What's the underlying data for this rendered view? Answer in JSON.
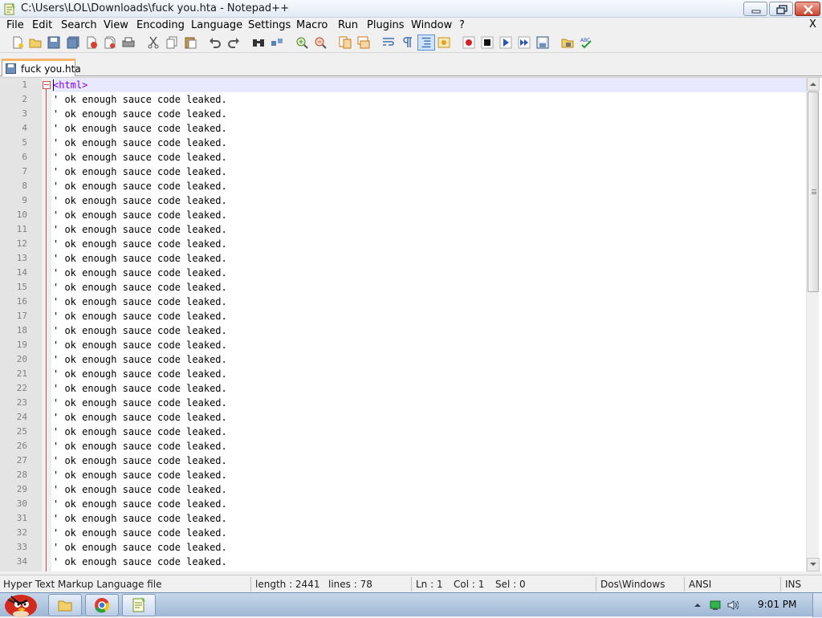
{
  "window": {
    "title": "C:\\Users\\LOL\\Downloads\\fuck you.hta - Notepad++",
    "close_glyph": "X"
  },
  "menu": {
    "items": [
      "File",
      "Edit",
      "Search",
      "View",
      "Encoding",
      "Language",
      "Settings",
      "Macro",
      "Run",
      "Plugins",
      "Window",
      "?"
    ],
    "doc_close": "X"
  },
  "toolbar": {
    "icons": [
      "new-file-icon",
      "open-file-icon",
      "save-icon",
      "save-all-icon",
      "close-icon",
      "close-all-icon",
      "print-icon",
      "cut-icon",
      "copy-icon",
      "paste-icon",
      "undo-icon",
      "redo-icon",
      "find-icon",
      "replace-icon",
      "zoom-in-icon",
      "zoom-out-icon",
      "sync-v-icon",
      "sync-h-icon",
      "word-wrap-icon",
      "show-all-chars-icon",
      "indent-guide-icon",
      "doc-map-icon",
      "record-macro-icon",
      "stop-record-icon",
      "play-macro-icon",
      "run-macro-multiple-icon",
      "save-macro-icon",
      "folder-icon",
      "spellcheck-icon"
    ]
  },
  "tabs": [
    {
      "label": "fuck you.hta",
      "active": true
    }
  ],
  "editor": {
    "lines": [
      {
        "n": "1",
        "text": "<html>",
        "tag": true
      },
      {
        "n": "2",
        "text": "' ok enough sauce code leaked."
      },
      {
        "n": "3",
        "text": "' ok enough sauce code leaked."
      },
      {
        "n": "4",
        "text": "' ok enough sauce code leaked."
      },
      {
        "n": "5",
        "text": "' ok enough sauce code leaked."
      },
      {
        "n": "6",
        "text": "' ok enough sauce code leaked."
      },
      {
        "n": "7",
        "text": "' ok enough sauce code leaked."
      },
      {
        "n": "8",
        "text": "' ok enough sauce code leaked."
      },
      {
        "n": "9",
        "text": "' ok enough sauce code leaked."
      },
      {
        "n": "10",
        "text": "' ok enough sauce code leaked."
      },
      {
        "n": "11",
        "text": "' ok enough sauce code leaked."
      },
      {
        "n": "12",
        "text": "' ok enough sauce code leaked."
      },
      {
        "n": "13",
        "text": "' ok enough sauce code leaked."
      },
      {
        "n": "14",
        "text": "' ok enough sauce code leaked."
      },
      {
        "n": "15",
        "text": "' ok enough sauce code leaked."
      },
      {
        "n": "16",
        "text": "' ok enough sauce code leaked."
      },
      {
        "n": "17",
        "text": "' ok enough sauce code leaked."
      },
      {
        "n": "18",
        "text": "' ok enough sauce code leaked."
      },
      {
        "n": "19",
        "text": "' ok enough sauce code leaked."
      },
      {
        "n": "20",
        "text": "' ok enough sauce code leaked."
      },
      {
        "n": "21",
        "text": "' ok enough sauce code leaked."
      },
      {
        "n": "22",
        "text": "' ok enough sauce code leaked."
      },
      {
        "n": "23",
        "text": "' ok enough sauce code leaked."
      },
      {
        "n": "24",
        "text": "' ok enough sauce code leaked."
      },
      {
        "n": "25",
        "text": "' ok enough sauce code leaked."
      },
      {
        "n": "26",
        "text": "' ok enough sauce code leaked."
      },
      {
        "n": "27",
        "text": "' ok enough sauce code leaked."
      },
      {
        "n": "28",
        "text": "' ok enough sauce code leaked."
      },
      {
        "n": "29",
        "text": "' ok enough sauce code leaked."
      },
      {
        "n": "30",
        "text": "' ok enough sauce code leaked."
      },
      {
        "n": "31",
        "text": "' ok enough sauce code leaked."
      },
      {
        "n": "32",
        "text": "' ok enough sauce code leaked."
      },
      {
        "n": "33",
        "text": "' ok enough sauce code leaked."
      },
      {
        "n": "34",
        "text": "' ok enough sauce code leaked."
      }
    ]
  },
  "status": {
    "filetype": "Hyper Text Markup Language file",
    "length": "length : 2441",
    "lines": "lines : 78",
    "ln": "Ln : 1",
    "col": "Col : 1",
    "sel": "Sel : 0",
    "eol": "Dos\\Windows",
    "encoding": "ANSI",
    "mode": "INS"
  },
  "taskbar": {
    "clock": "9:01 PM",
    "pinned": [
      "explorer-icon",
      "chrome-icon",
      "notepadpp-icon"
    ],
    "tray": [
      "show-hidden-icons-icon",
      "network-icon",
      "volume-icon"
    ]
  },
  "colors": {
    "tag": "#8000ff",
    "current_line": "#e8e8ff",
    "fold": "#d24a4a",
    "tab_accent": "#fab46a"
  }
}
